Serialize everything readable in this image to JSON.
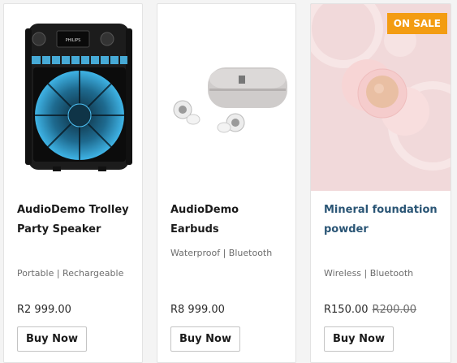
{
  "products": [
    {
      "title_line1": "AudioDemo Trolley",
      "title_line2": "Party Speaker",
      "features": "Portable | Rechargeable",
      "price": "R2 999.00",
      "buy_label": "Buy Now",
      "speaker_brand": "PHILIPS"
    },
    {
      "title_line1": "AudioDemo Earbuds",
      "features": "Waterproof | Bluetooth",
      "price": "R8 999.00",
      "buy_label": "Buy Now"
    },
    {
      "title_line1": "Mineral foundation",
      "title_line2": "powder",
      "features": "Wireless | Bluetooth",
      "price": "R150.00",
      "old_price": "R200.00",
      "badge": "ON SALE",
      "buy_label": "Buy Now"
    }
  ],
  "colors": {
    "sale_badge": "#f39c12",
    "link_title": "#2a5575",
    "speaker_glow": "#4fc3f7"
  }
}
